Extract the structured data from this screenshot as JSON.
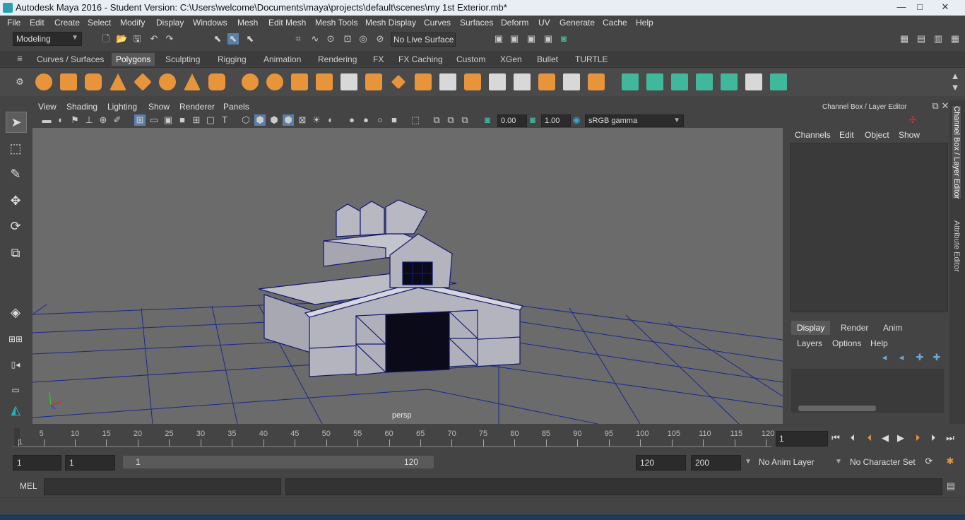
{
  "window": {
    "title": "Autodesk Maya 2016 - Student Version: C:\\Users\\welcome\\Documents\\maya\\projects\\default\\scenes\\my 1st Exterior.mb*",
    "minimize": "—",
    "maximize": "□",
    "close": "✕"
  },
  "menubar": [
    "File",
    "Edit",
    "Create",
    "Select",
    "Modify",
    "Display",
    "Windows",
    "Mesh",
    "Edit Mesh",
    "Mesh Tools",
    "Mesh Display",
    "Curves",
    "Surfaces",
    "Deform",
    "UV",
    "Generate",
    "Cache",
    "Help"
  ],
  "toolbar": {
    "mode": "Modeling",
    "live_surface": "No Live Surface"
  },
  "shelf_tabs": [
    "Curves / Surfaces",
    "Polygons",
    "Sculpting",
    "Rigging",
    "Animation",
    "Rendering",
    "FX",
    "FX Caching",
    "Custom",
    "XGen",
    "Bullet",
    "TURTLE"
  ],
  "active_shelf_tab": "Polygons",
  "viewport": {
    "menus": [
      "View",
      "Shading",
      "Lighting",
      "Show",
      "Renderer",
      "Panels"
    ],
    "exposure": "0.00",
    "gamma": "1.00",
    "color_space": "sRGB gamma",
    "camera": "persp"
  },
  "channel_box": {
    "title": "Channel Box / Layer Editor",
    "menus": [
      "Channels",
      "Edit",
      "Object",
      "Show"
    ],
    "layer_tabs": [
      "Display",
      "Render",
      "Anim"
    ],
    "active_layer_tab": "Display",
    "layer_menus": [
      "Layers",
      "Options",
      "Help"
    ]
  },
  "side_tabs": [
    "Channel Box / Layer Editor",
    "Attribute Editor"
  ],
  "time_slider": {
    "ticks": [
      "1",
      "5",
      "10",
      "15",
      "20",
      "25",
      "30",
      "35",
      "40",
      "45",
      "50",
      "55",
      "60",
      "65",
      "70",
      "75",
      "80",
      "85",
      "90",
      "95",
      "100",
      "105",
      "110",
      "115",
      "120"
    ],
    "current_frame": "1"
  },
  "range": {
    "start": "1",
    "playback_start": "1",
    "bar_start": "1",
    "bar_end": "120",
    "playback_end": "120",
    "end": "200",
    "anim_layer": "No Anim Layer",
    "character_set": "No Character Set"
  },
  "command": {
    "label": "MEL"
  },
  "colors": {
    "accent": "#e8943a",
    "teal": "#3fb89c",
    "viewport_bg": "#6b6b6b",
    "grid": "#1a2a8a"
  }
}
